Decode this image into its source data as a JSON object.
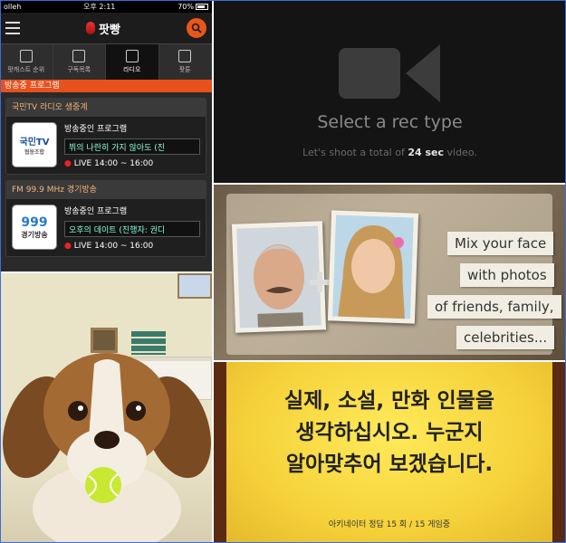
{
  "radio_app": {
    "status": {
      "carrier": "olleh",
      "time": "오후 2:11",
      "battery": "70%"
    },
    "app_title": "팟빵",
    "tabs": [
      {
        "label": "팟캐스트 순위"
      },
      {
        "label": "구독목록"
      },
      {
        "label": "라디오"
      },
      {
        "label": "팟툰"
      }
    ],
    "section_title": "방송중 프로그램",
    "stations": [
      {
        "name": "국민TV 라디오 생중계",
        "logo_text": "국민TV",
        "logo_sub": "협동조합",
        "heading": "방송중인 프로그램",
        "program": "뷔의 나란히 가지 않아도 (진",
        "live": "LIVE 14:00 ~ 16:00"
      },
      {
        "name": "FM 99.9 MHz 경기방송",
        "logo_text": "999",
        "logo_sub": "경기방송",
        "heading": "방송중인 프로그램",
        "program": "오후의 데이트 (진행자: 권디",
        "live": "LIVE 14:00 ~ 16:00"
      }
    ],
    "colors": {
      "accent": "#e8501c",
      "header_text": "#f2b27a"
    }
  },
  "rec": {
    "title": "Select a rec type",
    "sub_before": "Let's shoot a total of ",
    "sub_bold": "24 sec",
    "sub_after": " video.",
    "icon": "video-camera-icon"
  },
  "mix": {
    "lines": [
      "Mix your face",
      "with photos",
      "of friends, family,",
      "celebrities..."
    ]
  },
  "puppy": {
    "icon": "tennis-ball-icon"
  },
  "akinator": {
    "lines": [
      "실제, 소설, 만화 인물을",
      "생각하십시오. 누군지",
      "알아맞추어 보겠습니다."
    ],
    "counter": "아키네이터 정답 15 회 / 15 게임중"
  }
}
